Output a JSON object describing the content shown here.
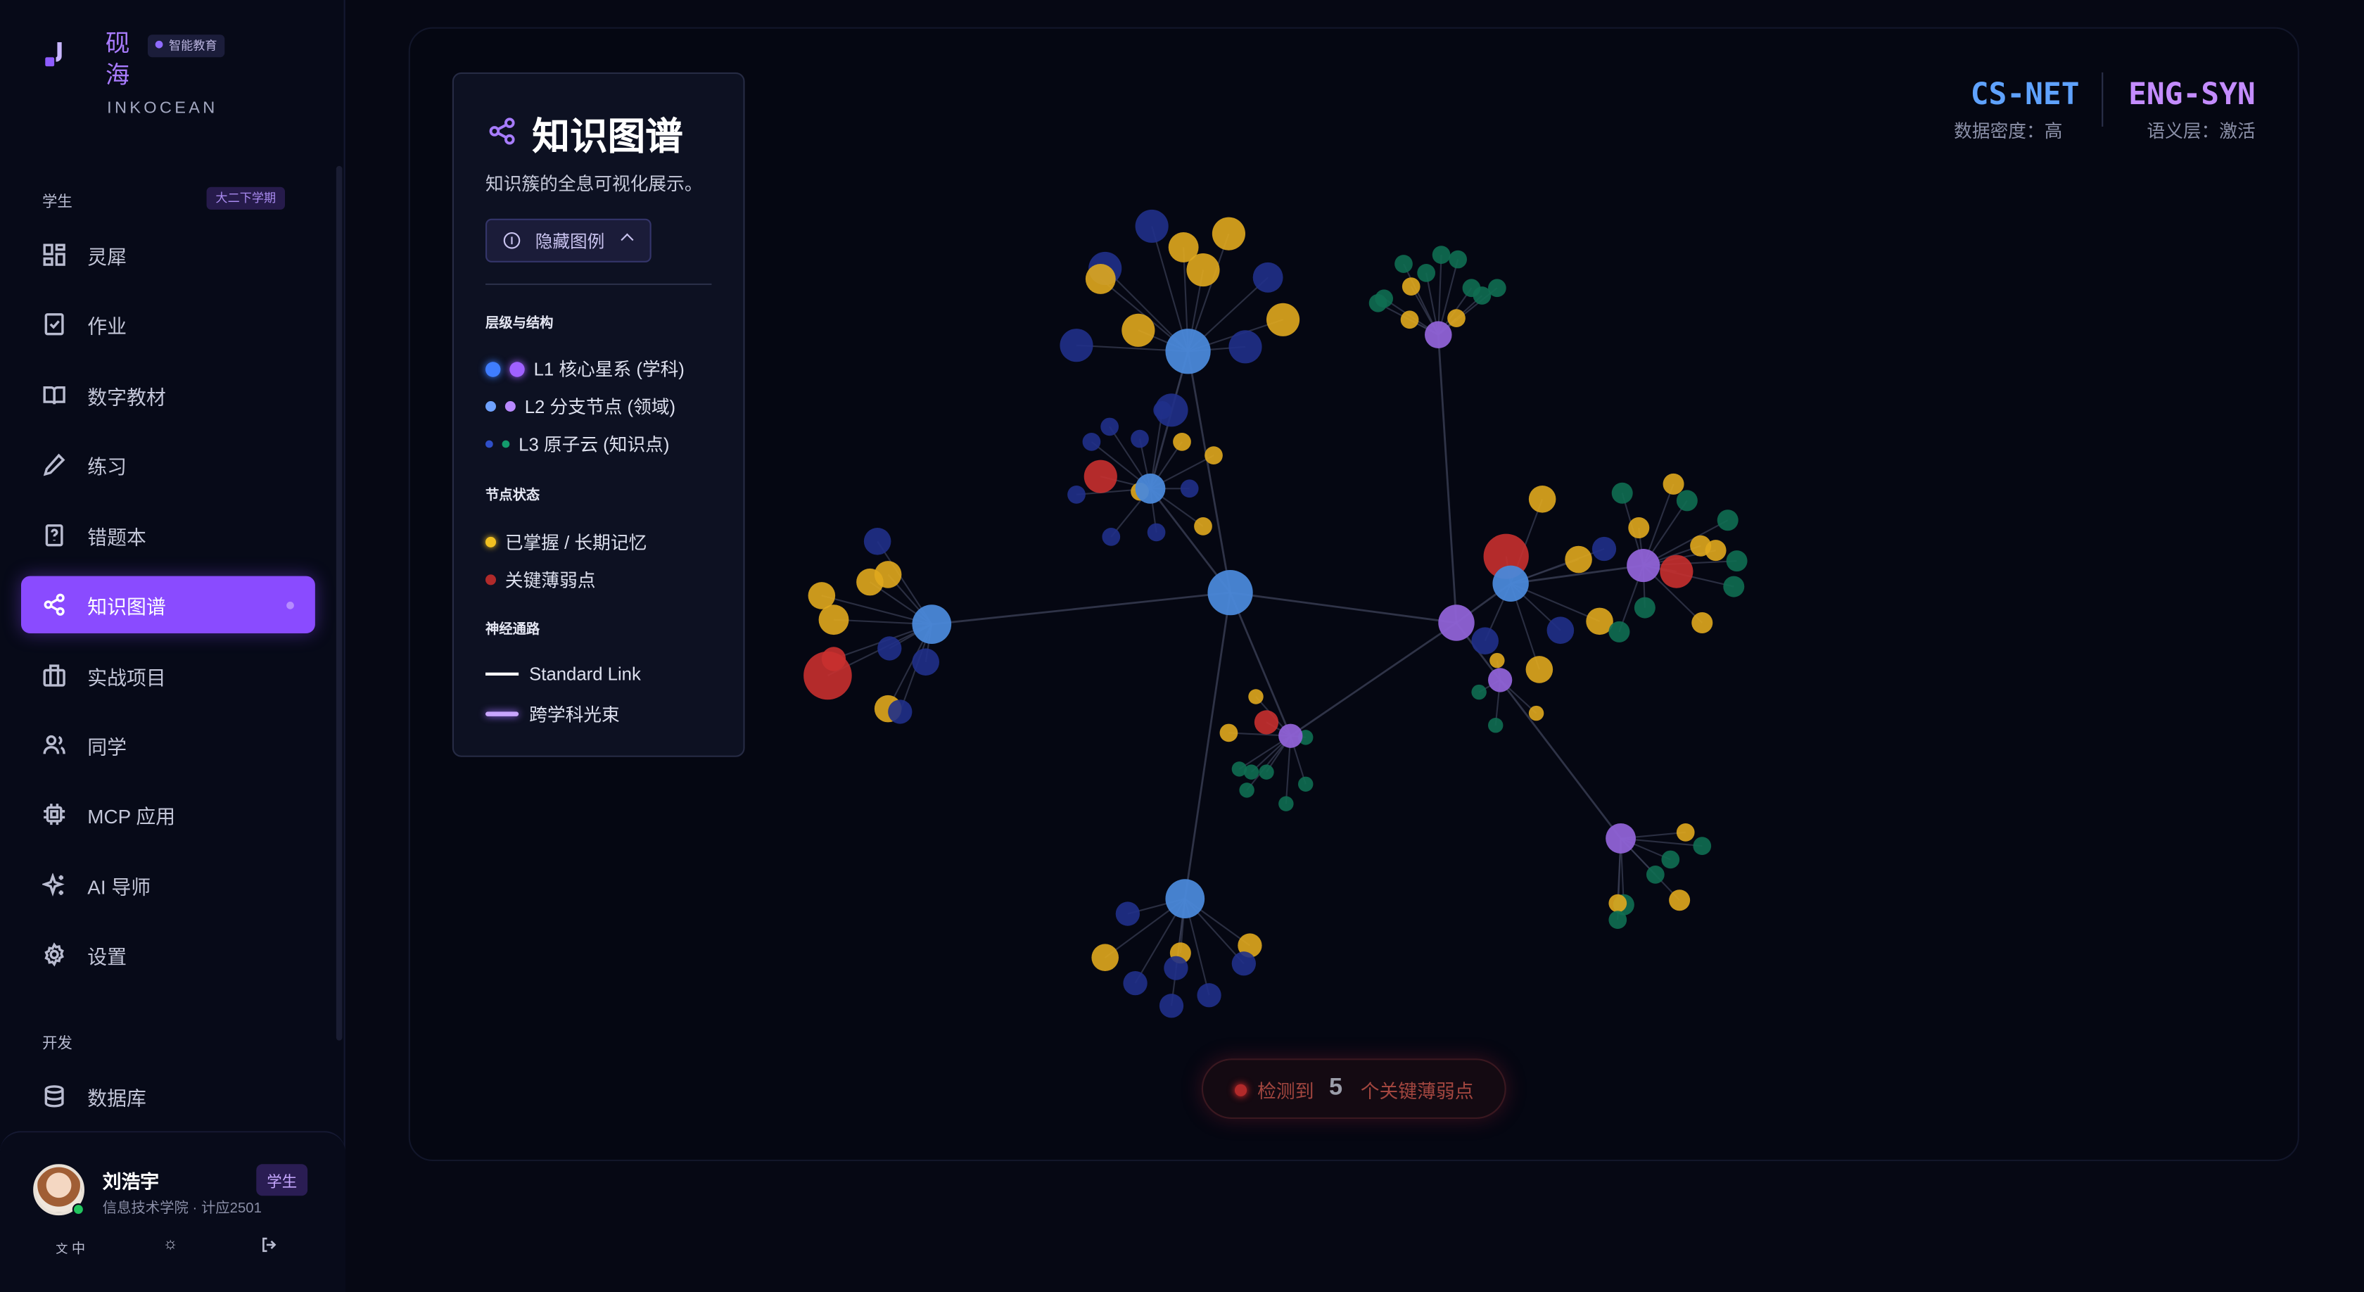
{
  "brand": {
    "name_cn": "砚海",
    "name_en": "INKOCEAN",
    "badge": "智能教育"
  },
  "sidebar": {
    "section_student": "学生",
    "term": "大二下学期",
    "items": [
      {
        "label": "灵犀",
        "icon": "grid-icon"
      },
      {
        "label": "作业",
        "icon": "clipboard-check-icon"
      },
      {
        "label": "数字教材",
        "icon": "book-icon"
      },
      {
        "label": "练习",
        "icon": "pen-icon"
      },
      {
        "label": "错题本",
        "icon": "question-file-icon"
      },
      {
        "label": "知识图谱",
        "icon": "share-icon",
        "active": true
      },
      {
        "label": "实战项目",
        "icon": "briefcase-icon"
      },
      {
        "label": "同学",
        "icon": "users-icon"
      },
      {
        "label": "MCP 应用",
        "icon": "chip-icon"
      },
      {
        "label": "AI 导师",
        "icon": "sparkles-icon"
      },
      {
        "label": "设置",
        "icon": "gear-icon"
      }
    ],
    "section_dev": "开发",
    "dev_items": [
      {
        "label": "数据库",
        "icon": "database-icon"
      }
    ]
  },
  "user": {
    "name": "刘浩宇",
    "meta": "信息技术学院 · 计应2501",
    "role": "学生",
    "lang": "中"
  },
  "legend": {
    "title": "知识图谱",
    "subtitle": "知识簇的全息可视化展示。",
    "toggle": "隐藏图例",
    "h_levels": "层级与结构",
    "l1": "L1 核心星系 (学科)",
    "l2": "L2 分支节点 (领域)",
    "l3": "L3 原子云 (知识点)",
    "h_status": "节点状态",
    "mastered": "已掌握 / 长期记忆",
    "weak": "关键薄弱点",
    "h_links": "神经通路",
    "link_std": "Standard Link",
    "link_cross": "跨学科光束"
  },
  "stats": {
    "a_code": "CS-NET",
    "a_label": "数据密度：高",
    "b_code": "ENG-SYN",
    "b_label": "语义层：激活"
  },
  "alert": {
    "prefix": "检测到",
    "count": "5",
    "suffix": "个关键薄弱点"
  },
  "colors": {
    "blue": "#4a88d9",
    "purple": "#8f62d6",
    "gold": "#e0a81e",
    "red": "#c8302f",
    "navy": "#20308a",
    "green": "#0f6e52"
  }
}
